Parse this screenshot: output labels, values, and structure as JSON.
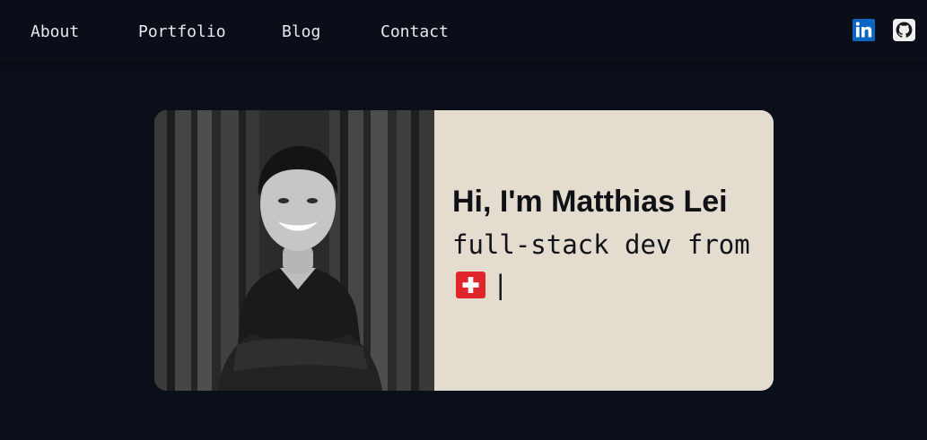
{
  "nav": {
    "links": [
      "About",
      "Portfolio",
      "Blog",
      "Contact"
    ]
  },
  "social": {
    "linkedin_icon": "linkedin-icon",
    "github_icon": "github-icon",
    "linkedin_color": "#0a66c2",
    "github_color": "#f0f0f0"
  },
  "hero": {
    "headline": "Hi, I'm Matthias Lei",
    "tagline": "full-stack dev from",
    "flag_icon": "swiss-flag-icon",
    "caret": "|",
    "portrait_icon": "portrait-photo",
    "card_color": "#e3dccf"
  },
  "theme": {
    "background": "#0b0f19",
    "nav_background": "#0a0e18",
    "nav_text": "#e7e9ee"
  }
}
